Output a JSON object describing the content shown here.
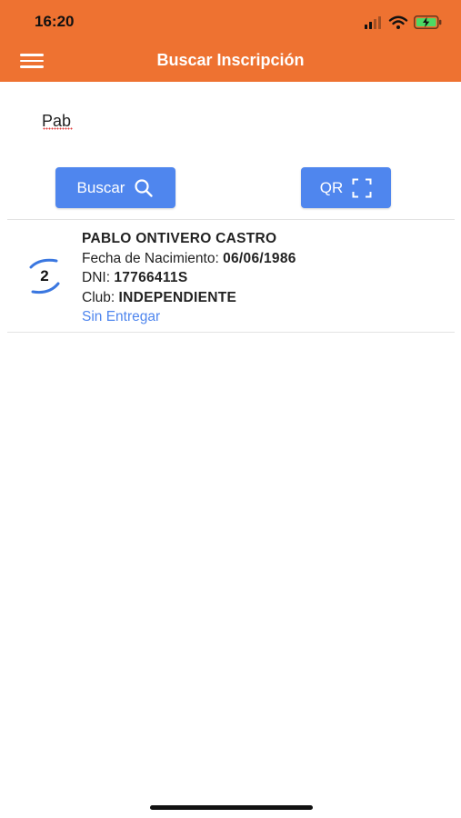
{
  "status_bar": {
    "time": "16:20",
    "icons": [
      "signal-icon",
      "wifi-icon",
      "battery-charging-icon"
    ],
    "battery_color": "#4CD964"
  },
  "header": {
    "title": "Buscar Inscripción",
    "menu_icon": "hamburger-menu-icon",
    "background": "#EE7231"
  },
  "search": {
    "value": "Pab",
    "placeholder": ""
  },
  "buttons": {
    "search_label": "Buscar",
    "search_icon": "search-icon",
    "qr_label": "QR",
    "qr_icon": "qr-scan-icon",
    "color": "#4F86EE"
  },
  "results": [
    {
      "badge": "2",
      "name": "PABLO ONTIVERO CASTRO",
      "birth_label": "Fecha de Nacimiento:",
      "birth_value": "06/06/1986",
      "dni_label": "DNI:",
      "dni_value": "17766411S",
      "club_label": "Club:",
      "club_value": "INDEPENDIENTE",
      "status": "Sin Entregar"
    }
  ]
}
